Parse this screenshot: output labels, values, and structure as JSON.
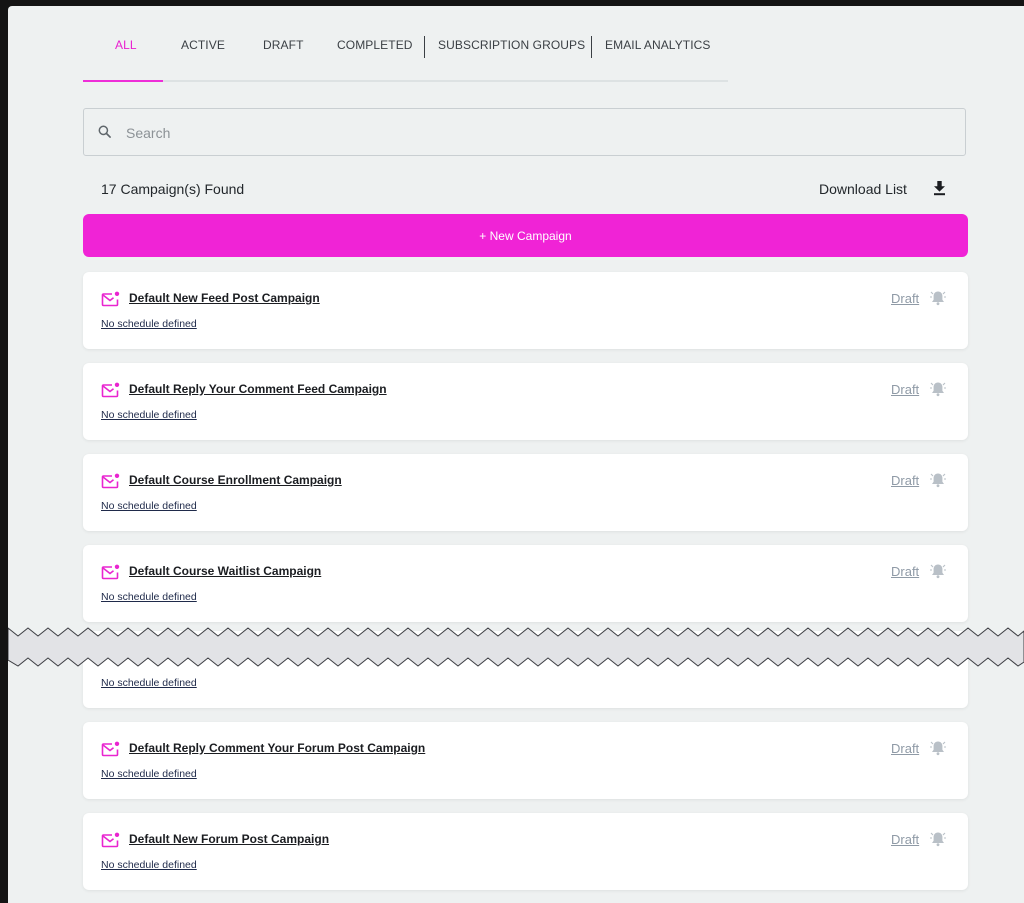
{
  "tabs": [
    {
      "label": "ALL",
      "active": true
    },
    {
      "label": "ACTIVE",
      "active": false
    },
    {
      "label": "DRAFT",
      "active": false
    },
    {
      "label": "COMPLETED",
      "active": false
    },
    {
      "label": "SUBSCRIPTION GROUPS",
      "active": false
    },
    {
      "label": "EMAIL ANALYTICS",
      "active": false
    }
  ],
  "search": {
    "placeholder": "Search",
    "icon": "search-icon"
  },
  "campaigns_found": "17 Campaign(s) Found",
  "download": {
    "label": "Download List",
    "icon": "download-icon"
  },
  "new_campaign": {
    "label": "+ New Campaign"
  },
  "cards": [
    {
      "title": "Default New Feed Post Campaign",
      "schedule": "No schedule defined",
      "status": "Draft"
    },
    {
      "title": "Default Reply Your Comment Feed Campaign",
      "schedule": "No schedule defined",
      "status": "Draft"
    },
    {
      "title": "Default Course Enrollment Campaign",
      "schedule": "No schedule defined",
      "status": "Draft"
    },
    {
      "title": "Default Course Waitlist Campaign",
      "schedule": "No schedule defined",
      "status": "Draft"
    },
    {
      "title": "",
      "schedule": "No schedule defined",
      "status": ""
    },
    {
      "title": "Default Reply Comment Your Forum Post Campaign",
      "schedule": "No schedule defined",
      "status": "Draft"
    },
    {
      "title": "Default New Forum Post Campaign",
      "schedule": "No schedule defined",
      "status": "Draft"
    }
  ],
  "colors": {
    "accent": "#f023d6",
    "active_tab": "#e91fd0",
    "background": "#eef1f1",
    "status_text": "#8f9aa6",
    "window_frame": "#141414"
  }
}
